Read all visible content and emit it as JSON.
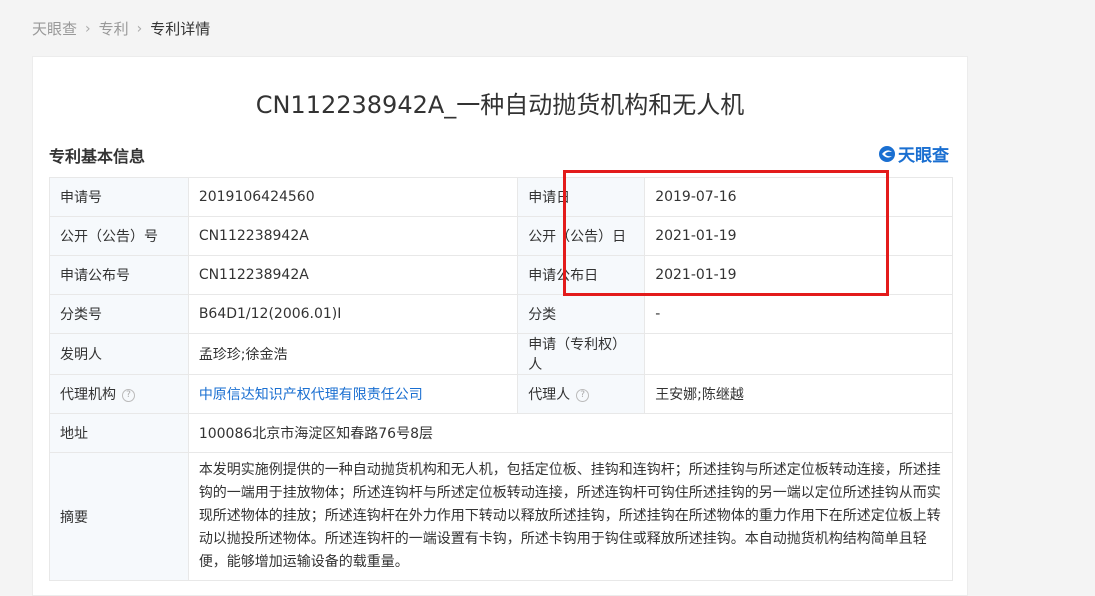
{
  "breadcrumb": {
    "home": "天眼查",
    "level2": "专利",
    "current": "专利详情"
  },
  "title": "CN112238942A_一种自动抛货机构和无人机",
  "section_title": "专利基本信息",
  "logo_text": "天眼查",
  "rows": [
    {
      "label": "申请号",
      "value": "2019106424560",
      "label2": "申请日",
      "value2": "2019-07-16"
    },
    {
      "label": "公开（公告）号",
      "value": "CN112238942A",
      "label2": "公开（公告）日",
      "value2": "2021-01-19"
    },
    {
      "label": "申请公布号",
      "value": "CN112238942A",
      "label2": "申请公布日",
      "value2": "2021-01-19"
    },
    {
      "label": "分类号",
      "value": "B64D1/12(2006.01)I",
      "label2": "分类",
      "value2": "-"
    },
    {
      "label": "发明人",
      "value": "孟珍珍;徐金浩",
      "label2": "申请（专利权）人",
      "value2": ""
    },
    {
      "label": "代理机构",
      "value": "中原信达知识产权代理有限责任公司",
      "label2": "代理人",
      "value2": "王安娜;陈继越"
    }
  ],
  "address": {
    "label": "地址",
    "value": "100086北京市海淀区知春路76号8层"
  },
  "abstract": {
    "label": "摘要",
    "value": "本发明实施例提供的一种自动抛货机构和无人机，包括定位板、挂钩和连钩杆；所述挂钩与所述定位板转动连接，所述挂钩的一端用于挂放物体；所述连钩杆与所述定位板转动连接，所述连钩杆可钩住所述挂钩的另一端以定位所述挂钩从而实现所述物体的挂放；所述连钩杆在外力作用下转动以释放所述挂钩，所述挂钩在所述物体的重力作用下在所述定位板上转动以抛投所述物体。所述连钩杆的一端设置有卡钩，所述卡钩用于钩住或释放所述挂钩。本自动抛货机构结构简单且轻便，能够增加运输设备的载重量。"
  },
  "help_icon": "?",
  "colors": {
    "link": "#1a6fd1",
    "highlight": "#e31b1b",
    "label_bg": "#f6f9fc"
  }
}
